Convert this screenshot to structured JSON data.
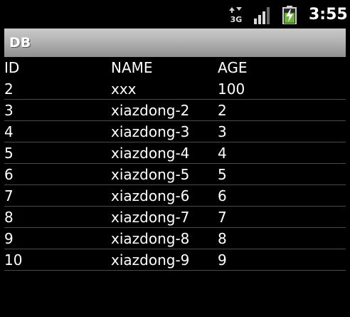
{
  "status_bar": {
    "network_label": "3G",
    "time": "3:55",
    "icons": [
      "3g-data-icon",
      "signal-strength-icon",
      "battery-charging-icon"
    ]
  },
  "title_bar": {
    "title": "DB"
  },
  "table": {
    "headers": {
      "id": "ID",
      "name": "NAME",
      "age": "AGE"
    },
    "rows": [
      {
        "id": "2",
        "name": "xxx",
        "age": "100"
      },
      {
        "id": "3",
        "name": "xiazdong-2",
        "age": "2"
      },
      {
        "id": "4",
        "name": "xiazdong-3",
        "age": "3"
      },
      {
        "id": "5",
        "name": "xiazdong-4",
        "age": "4"
      },
      {
        "id": "6",
        "name": "xiazdong-5",
        "age": "5"
      },
      {
        "id": "7",
        "name": "xiazdong-6",
        "age": "6"
      },
      {
        "id": "8",
        "name": "xiazdong-7",
        "age": "7"
      },
      {
        "id": "9",
        "name": "xiazdong-8",
        "age": "8"
      },
      {
        "id": "10",
        "name": "xiazdong-9",
        "age": "9"
      }
    ]
  },
  "colors": {
    "background": "#000000",
    "text": "#ffffff",
    "title_bar": "#b3b3b3",
    "battery_fill": "#6ab82e",
    "row_divider": "#4a4a4a"
  }
}
